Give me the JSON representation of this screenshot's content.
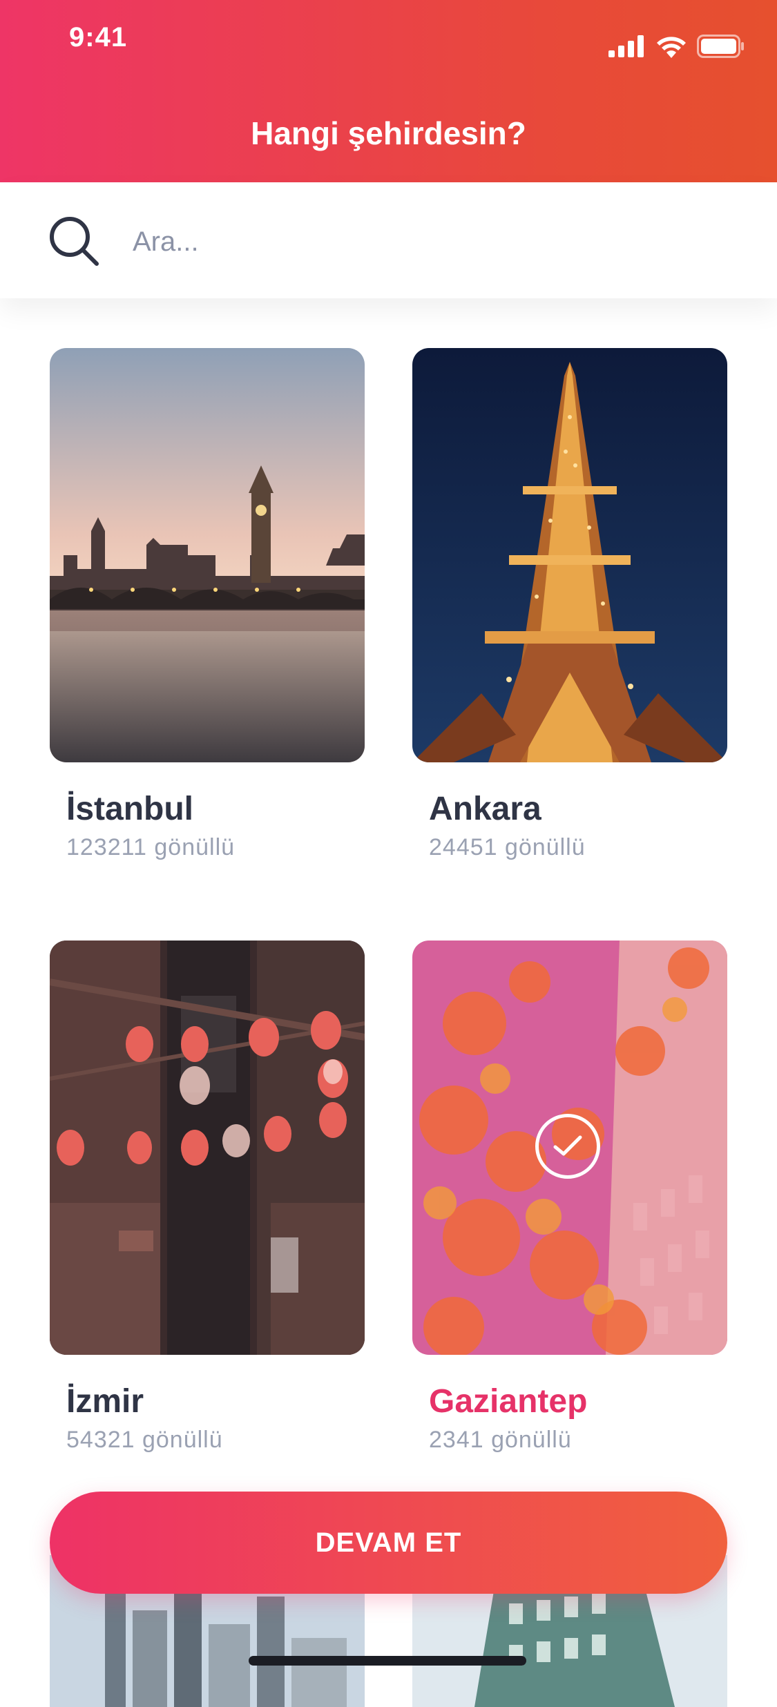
{
  "status_bar": {
    "time": "9:41"
  },
  "header": {
    "title": "Hangi şehirdesin?"
  },
  "search": {
    "placeholder": "Ara..."
  },
  "cities": [
    {
      "name": "İstanbul",
      "count": "123211 gönüllü",
      "selected": false
    },
    {
      "name": "Ankara",
      "count": "24451 gönüllü",
      "selected": false
    },
    {
      "name": "İzmir",
      "count": "54321 gönüllü",
      "selected": false
    },
    {
      "name": "Gaziantep",
      "count": "2341 gönüllü",
      "selected": true
    }
  ],
  "cta": {
    "label": "DEVAM ET"
  },
  "colors": {
    "accent": "#e63268",
    "gradient_start": "#ee3566",
    "gradient_end": "#e6502e",
    "text_primary": "#2f3445",
    "text_secondary": "#9aa1b2"
  }
}
